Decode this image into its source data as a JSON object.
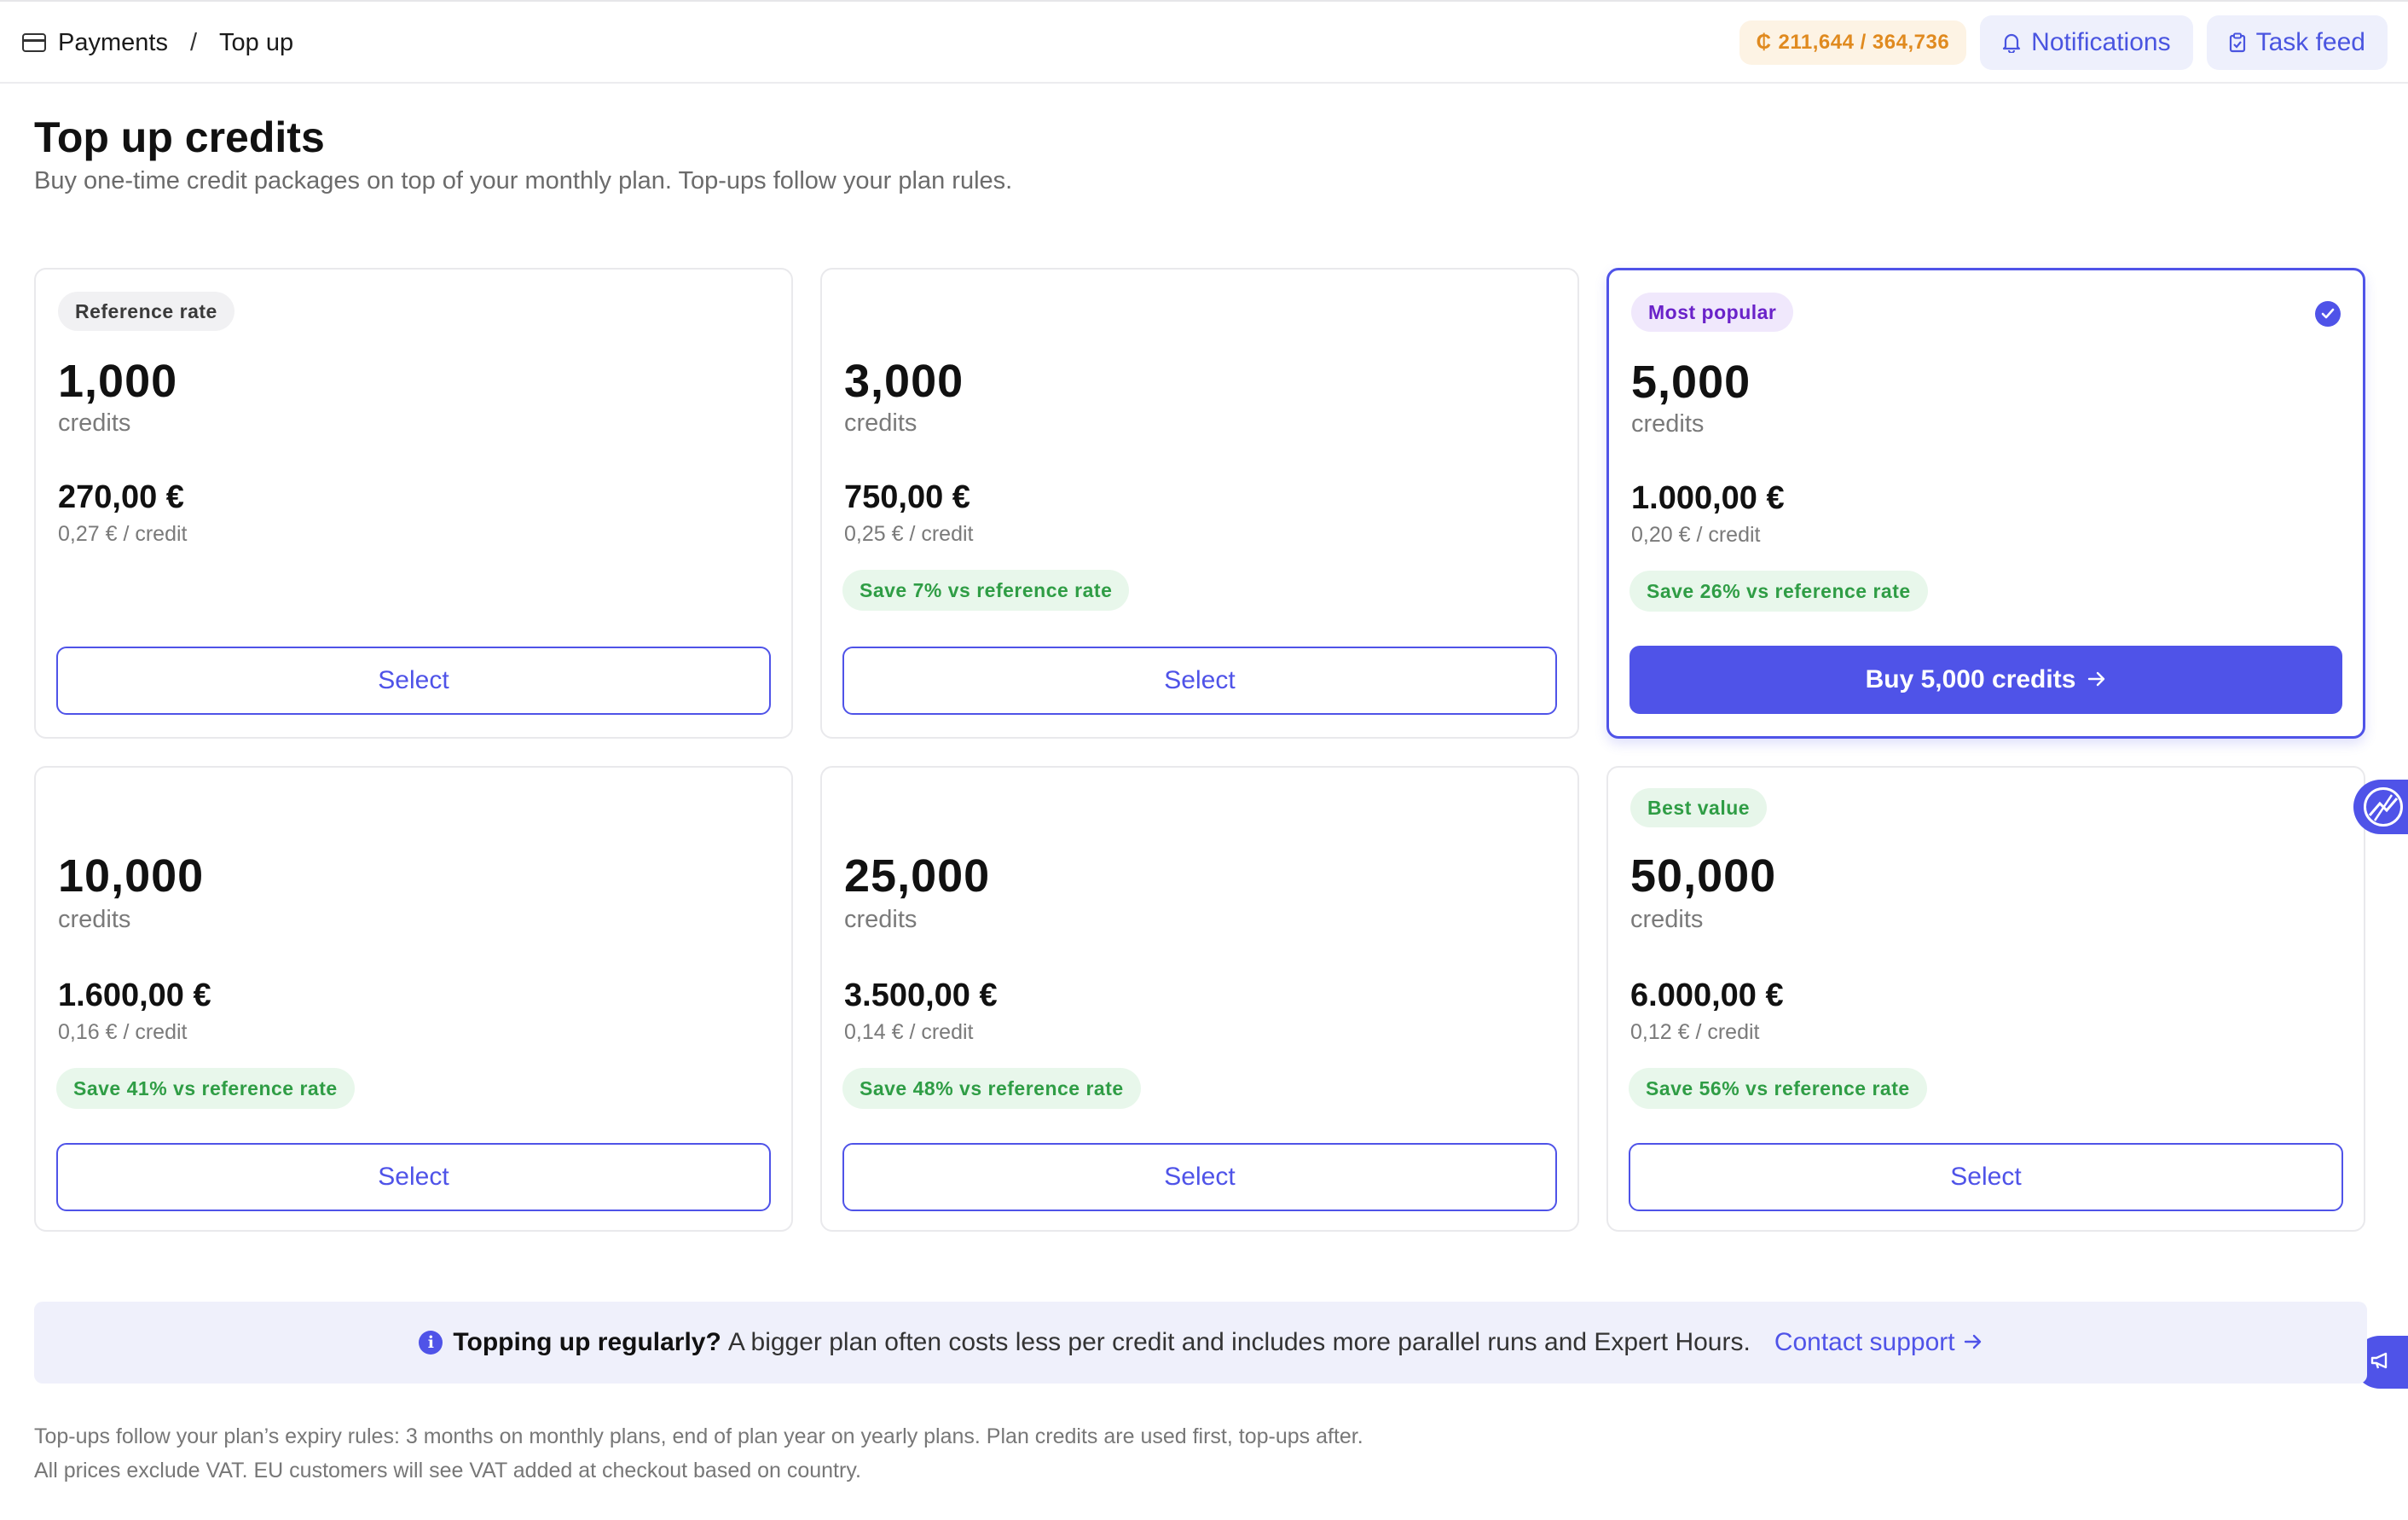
{
  "breadcrumb": {
    "section": "Payments",
    "separator": "/",
    "current": "Top up"
  },
  "header": {
    "credit_symbol": "₵",
    "credit_balance": "211,644 / 364,736",
    "notifications_label": "Notifications",
    "task_feed_label": "Task feed"
  },
  "page": {
    "title": "Top up credits",
    "subtitle": "Buy one-time credit packages on top of your monthly plan. Top-ups follow your plan rules."
  },
  "packages": [
    {
      "badge": "Reference rate",
      "amount": "1,000",
      "unit": "credits",
      "price": "270,00 €",
      "per_credit": "0,27 € / credit",
      "save": "",
      "action": "Select"
    },
    {
      "badge": "",
      "amount": "3,000",
      "unit": "credits",
      "price": "750,00 €",
      "per_credit": "0,25 € / credit",
      "save": "Save 7% vs reference rate",
      "action": "Select"
    },
    {
      "badge": "Most popular",
      "amount": "5,000",
      "unit": "credits",
      "price": "1.000,00 €",
      "per_credit": "0,20 € / credit",
      "save": "Save 26% vs reference rate",
      "action": "Buy 5,000 credits",
      "selected": true
    },
    {
      "badge": "",
      "amount": "10,000",
      "unit": "credits",
      "price": "1.600,00 €",
      "per_credit": "0,16 € / credit",
      "save": "Save 41% vs reference rate",
      "action": "Select"
    },
    {
      "badge": "",
      "amount": "25,000",
      "unit": "credits",
      "price": "3.500,00 €",
      "per_credit": "0,14 € / credit",
      "save": "Save 48% vs reference rate",
      "action": "Select"
    },
    {
      "badge": "Best value",
      "amount": "50,000",
      "unit": "credits",
      "price": "6.000,00 €",
      "per_credit": "0,12 € / credit",
      "save": "Save 56% vs reference rate",
      "action": "Select"
    }
  ],
  "banner": {
    "bold": "Topping up regularly?",
    "text": "A bigger plan often costs less per credit and includes more parallel runs and Expert Hours.",
    "link": "Contact support"
  },
  "footer": {
    "line1": "Top-ups follow your plan’s expiry rules: 3 months on monthly plans, end of plan year on yearly plans. Plan credits are used first, top-ups after.",
    "line2": "All prices exclude VAT. EU customers will see VAT added at checkout based on country."
  },
  "colors": {
    "accent": "#4f53e8",
    "save_green": "#2f9d45",
    "popular_purple": "#6a22c9",
    "credit_orange": "#e08a1f"
  }
}
